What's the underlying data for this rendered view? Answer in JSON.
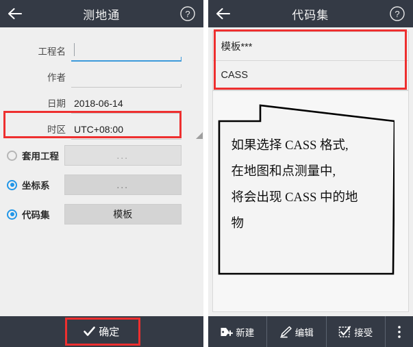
{
  "left": {
    "titlebar": {
      "back_icon": "arrow-left-icon",
      "title": "测地通",
      "help_icon": "help-circle-icon"
    },
    "fields": [
      {
        "label": "工程名",
        "value": "",
        "focused": true,
        "type": "text"
      },
      {
        "label": "作者",
        "value": "",
        "focused": false,
        "type": "text"
      },
      {
        "label": "日期",
        "value": "2018-06-14",
        "focused": false,
        "type": "text"
      },
      {
        "label": "时区",
        "value": "UTC+08:00",
        "focused": false,
        "type": "spinner"
      }
    ],
    "options": [
      {
        "label": "套用工程",
        "checked": false,
        "button_label": "...",
        "enabled": false
      },
      {
        "label": "坐标系",
        "checked": true,
        "button_label": "...",
        "enabled": true
      },
      {
        "label": "代码集",
        "checked": true,
        "button_label": "模板",
        "enabled": true,
        "highlighted": true
      }
    ],
    "bottom": {
      "confirm_label": "确定",
      "confirm_icon": "check-icon",
      "highlighted": true
    }
  },
  "right": {
    "titlebar": {
      "back_icon": "arrow-left-icon",
      "title": "代码集",
      "help_icon": "help-circle-icon"
    },
    "list": {
      "highlighted": true,
      "items": [
        {
          "label": "模板***"
        },
        {
          "label": "CASS"
        }
      ]
    },
    "callout": {
      "lines": [
        "如果选择 CASS 格式,",
        "在地图和点测量中,",
        "将会出现 CASS 中的地",
        "物"
      ]
    },
    "bottom": {
      "buttons": [
        {
          "label": "新建",
          "icon": "tag-plus-icon"
        },
        {
          "label": "编辑",
          "icon": "pencil-icon"
        },
        {
          "label": "接受",
          "icon": "checkbox-checked-icon"
        },
        {
          "label": "",
          "icon": "more-vertical-icon"
        }
      ]
    }
  },
  "colors": {
    "titlebar_bg": "#343a45",
    "accent_blue": "#2196e8",
    "annotation_red": "#ee2f2f",
    "page_bg": "#efefef"
  }
}
